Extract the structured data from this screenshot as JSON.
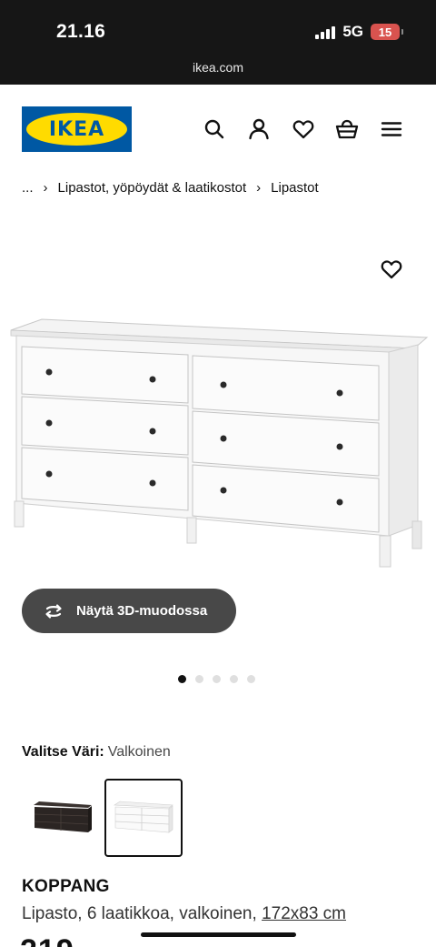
{
  "status_bar": {
    "time": "21.16",
    "network": "5G",
    "battery": "15"
  },
  "browser": {
    "url": "ikea.com"
  },
  "header": {
    "logo_text": "IKEA",
    "icons": [
      "search-icon",
      "account-icon",
      "favourites-icon",
      "basket-icon",
      "menu-icon"
    ]
  },
  "breadcrumb": {
    "items": [
      "...",
      "Lipastot, yöpöydät & laatikostot",
      "Lipastot"
    ]
  },
  "media": {
    "view_3d_label": "Näytä 3D-muodossa",
    "image_count": 5,
    "active_image": 1
  },
  "color": {
    "label": "Valitse Väri:",
    "value": "Valkoinen",
    "options": [
      "black-brown",
      "white"
    ],
    "selected": "white"
  },
  "product": {
    "name": "KOPPANG",
    "description": "Lipasto, 6 laatikkoa, valkoinen,",
    "size": "172x83 cm",
    "price_partial": "219"
  },
  "colors": {
    "brand_blue": "#0058a3",
    "brand_yellow": "#ffdb00",
    "button_dark": "#484848"
  }
}
